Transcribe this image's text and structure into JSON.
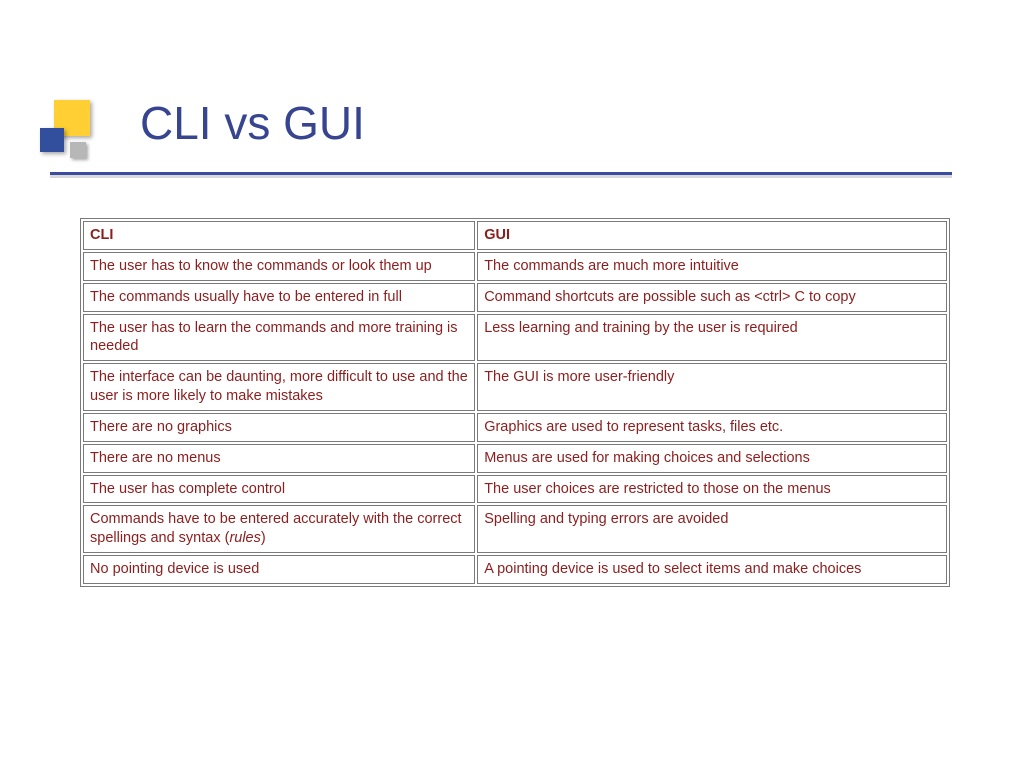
{
  "title": "CLI vs GUI",
  "table": {
    "headers": {
      "left": "CLI",
      "right": "GUI"
    },
    "rows": [
      {
        "left": "The user has to know the commands or look them up",
        "right": "The commands are much more intuitive"
      },
      {
        "left": "The commands usually have to be entered in full",
        "right": "Command shortcuts are possible such as <ctrl> C to copy"
      },
      {
        "left": "The user has to learn the commands and more training is needed",
        "right": "Less learning and training by the user is required"
      },
      {
        "left": "The interface can be daunting, more difficult to use and the user is more likely to make mistakes",
        "right": "The GUI is more user-friendly"
      },
      {
        "left": "There are no graphics",
        "right": "Graphics are used to represent tasks, files etc."
      },
      {
        "left": "There are no menus",
        "right": "Menus are used for making choices and selections"
      },
      {
        "left": "The user has complete control",
        "right": "The user choices are restricted to those on the menus"
      },
      {
        "left_prefix": "Commands have to be entered accurately with the correct spellings and syntax (",
        "left_italic": "rules",
        "left_suffix": ")",
        "right": "Spelling and typing errors are avoided"
      },
      {
        "left": "No pointing device is used",
        "right": "A pointing device is used to select items and make choices"
      }
    ]
  }
}
